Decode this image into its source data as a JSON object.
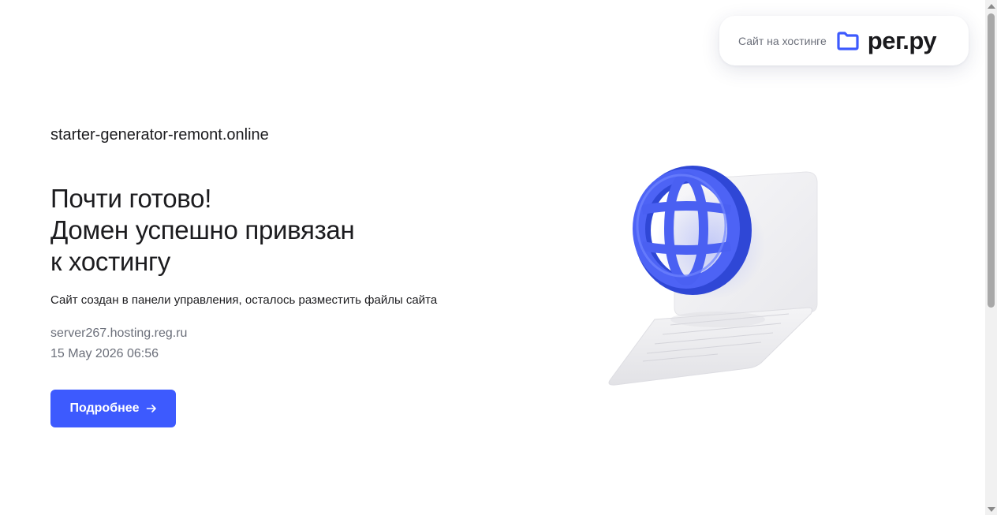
{
  "badge": {
    "text": "Сайт на хостинге",
    "brand": "рег.ру",
    "icon": "folder-icon"
  },
  "main": {
    "domain": "starter-generator-remont.online",
    "headline": [
      "Почти готово!",
      "Домен успешно привязан",
      "к хостингу"
    ],
    "subtitle": "Сайт создан в панели управления, осталось разместить файлы сайта",
    "server": "server267.hosting.reg.ru",
    "date": "15 May 2026 06:56",
    "button_label": "Подробнее",
    "button_icon": "arrow-right-icon"
  },
  "illustration": {
    "icons": [
      "laptop-icon",
      "globe-icon"
    ]
  },
  "colors": {
    "accent": "#3d5afe",
    "text": "#1c1c1f",
    "muted": "#6b6f7a"
  }
}
